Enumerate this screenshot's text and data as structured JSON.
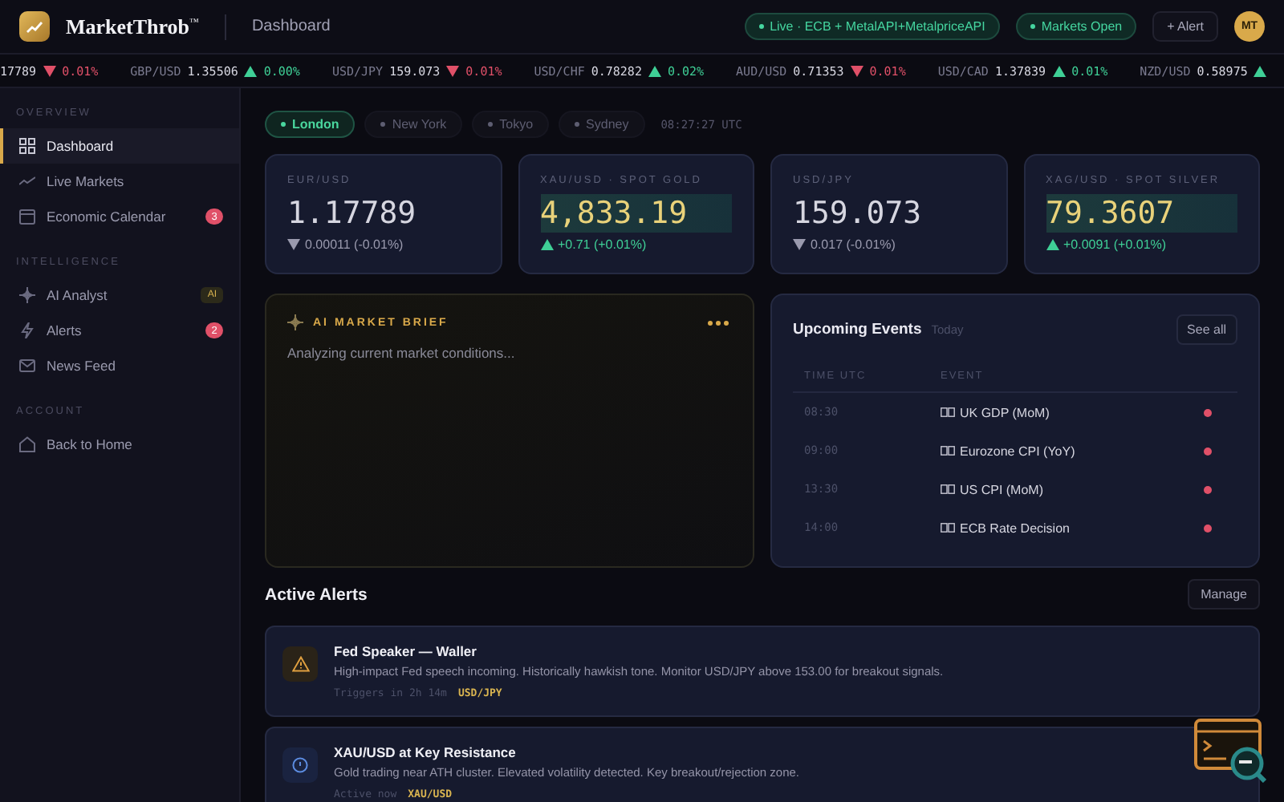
{
  "header": {
    "brand": "MarketThrob",
    "brand_mark": "™",
    "page_title": "Dashboard",
    "pills": [
      {
        "label": "Live · ECB + MetalAPI+MetalpriceAPI"
      },
      {
        "label": "Markets Open"
      }
    ],
    "alert_button": "+ Alert",
    "avatar": "MT"
  },
  "ticker": [
    {
      "price": "17789",
      "up": false,
      "change": "0.01%"
    },
    {
      "pair": "GBP/USD",
      "price": "1.35506",
      "up": true,
      "change": "0.00%"
    },
    {
      "pair": "USD/JPY",
      "price": "159.073",
      "up": false,
      "change": "0.01%"
    },
    {
      "pair": "USD/CHF",
      "price": "0.78282",
      "up": true,
      "change": "0.02%"
    },
    {
      "pair": "AUD/USD",
      "price": "0.71353",
      "up": false,
      "change": "0.01%"
    },
    {
      "pair": "USD/CAD",
      "price": "1.37839",
      "up": true,
      "change": "0.01%"
    },
    {
      "pair": "NZD/USD",
      "price": "0.58975",
      "up": true
    }
  ],
  "sidebar": {
    "sections": [
      {
        "title": "OVERVIEW",
        "items": [
          {
            "label": "Dashboard",
            "kind": "grid",
            "selected": true
          },
          {
            "label": "Live Markets",
            "kind": "trend",
            "selected": false
          },
          {
            "label": "Economic Calendar",
            "kind": "calendar",
            "selected": false,
            "badge": {
              "text": "3",
              "kind": "count"
            }
          }
        ]
      },
      {
        "title": "INTELLIGENCE",
        "items": [
          {
            "label": "AI Analyst",
            "kind": "sparkle",
            "selected": false,
            "badge": {
              "text": "AI",
              "kind": "tag"
            }
          },
          {
            "label": "Alerts",
            "kind": "bolt",
            "selected": false,
            "badge": {
              "text": "2",
              "kind": "count"
            }
          },
          {
            "label": "News Feed",
            "kind": "mail",
            "selected": false
          }
        ]
      },
      {
        "title": "ACCOUNT",
        "items": [
          {
            "label": "Back to Home",
            "kind": "home",
            "selected": false
          }
        ]
      }
    ]
  },
  "sessions": [
    {
      "label": "London",
      "selected": true
    },
    {
      "label": "New York",
      "selected": false
    },
    {
      "label": "Tokyo",
      "selected": false
    },
    {
      "label": "Sydney",
      "selected": false
    }
  ],
  "clock": "08:27:27 UTC",
  "quotes": [
    {
      "label": "EUR/USD",
      "price": "1.17789",
      "up": false,
      "change": "0.00011 (-0.01%)",
      "highlight": false
    },
    {
      "label": "XAU/USD · SPOT GOLD",
      "price": "4,833.19",
      "up": true,
      "change": "+0.71 (+0.01%)",
      "highlight": true
    },
    {
      "label": "USD/JPY",
      "price": "159.073",
      "up": false,
      "change": "0.017 (-0.01%)",
      "highlight": false
    },
    {
      "label": "XAG/USD · SPOT SILVER",
      "price": "79.3607",
      "up": true,
      "change": "+0.0091 (+0.01%)",
      "highlight": true
    }
  ],
  "ai_brief": {
    "title": "AI MARKET BRIEF",
    "text": "Analyzing current market conditions..."
  },
  "events": {
    "title": "Upcoming Events",
    "subtitle": "Today",
    "button": "See all",
    "columns": [
      "TIME UTC",
      "EVENT"
    ],
    "rows": [
      {
        "time": "08:30",
        "event": "UK GDP (MoM)",
        "high_impact": true
      },
      {
        "time": "09:00",
        "event": "Eurozone CPI (YoY)",
        "high_impact": true
      },
      {
        "time": "13:30",
        "event": "US CPI (MoM)",
        "high_impact": true
      },
      {
        "time": "14:00",
        "event": "ECB Rate Decision",
        "high_impact": true
      }
    ]
  },
  "alerts": {
    "title": "Active Alerts",
    "button": "Manage",
    "items": [
      {
        "kind": "warning",
        "title": "Fed Speaker — Waller",
        "text": "High-impact Fed speech incoming. Historically hawkish tone. Monitor USD/JPY above 153.00 for breakout signals.",
        "meta": "Triggers in 2h 14m",
        "tag": "USD/JPY"
      },
      {
        "kind": "info",
        "title": "XAU/USD at Key Resistance",
        "text": "Gold trading near ATH cluster. Elevated volatility detected. Key breakout/rejection zone.",
        "meta": "Active now",
        "tag": "XAU/USD"
      }
    ]
  }
}
